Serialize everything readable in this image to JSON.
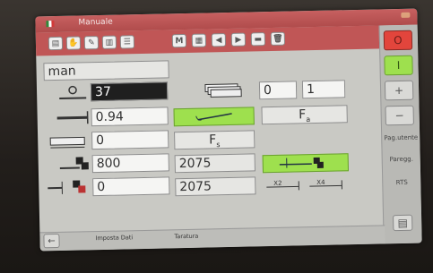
{
  "window": {
    "title": "Manuale"
  },
  "toolbar": {
    "buttons": [
      {
        "icon": "page-icon",
        "label": ""
      },
      {
        "icon": "hand-icon",
        "label": ""
      },
      {
        "icon": "wrench-icon",
        "label": ""
      },
      {
        "icon": "chart-icon",
        "label": ""
      },
      {
        "icon": "list-icon",
        "label": ""
      },
      {
        "icon": "m-icon",
        "label": "M"
      },
      {
        "icon": "save-icon",
        "label": ""
      },
      {
        "icon": "arrow-left-icon",
        "label": "◀"
      },
      {
        "icon": "arrow-right-icon",
        "label": "▶"
      },
      {
        "icon": "minus-icon",
        "label": ""
      },
      {
        "icon": "trash-icon",
        "label": ""
      }
    ]
  },
  "program": {
    "name": "man"
  },
  "rows": {
    "angle": "37",
    "thickness": "0.94",
    "width": "0",
    "x_axis": "800",
    "x_axis_2": "2075",
    "r_axis": "0",
    "r_axis_2": "2075",
    "sheet_count": "0",
    "sheet_total": "1",
    "fs_label": "F",
    "fs_sub": "s",
    "fa_label": "F",
    "fa_sub": "a"
  },
  "right_panel": {
    "stop_label": "O",
    "start_label": "I",
    "plus_label": "+",
    "minus_label": "−",
    "pag_utente": "Pag.utente",
    "paregg": "Paregg.",
    "rts": "RTS"
  },
  "bottom": {
    "imposta_dati": "Imposta Dati",
    "taratura": "Taratura"
  },
  "colors": {
    "title_red": "#c05656",
    "accent_green": "#9ee04e",
    "stop_red": "#e2453c"
  }
}
